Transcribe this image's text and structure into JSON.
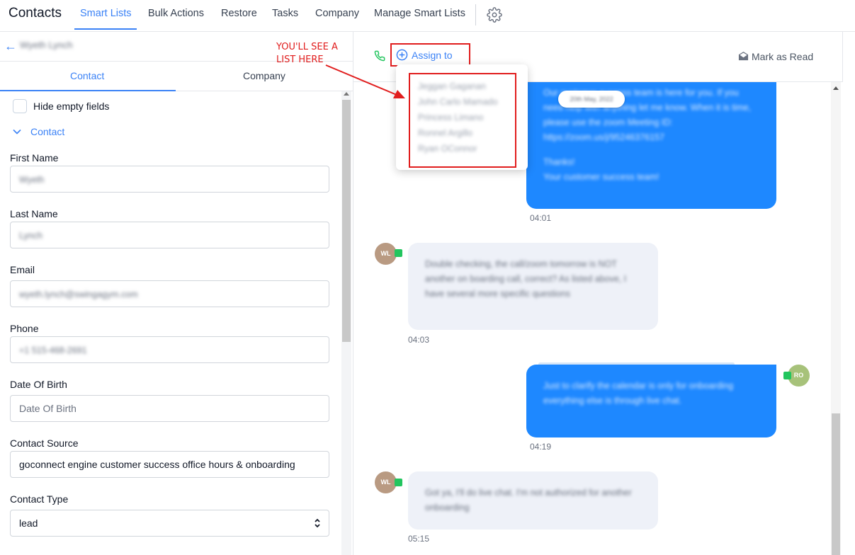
{
  "nav": {
    "app_title": "Contacts",
    "tabs": [
      "Smart Lists",
      "Bulk Actions",
      "Restore",
      "Tasks",
      "Company",
      "Manage Smart Lists"
    ],
    "settings_icon": "gear-icon"
  },
  "left": {
    "contact_name": "Wyeth Lynch",
    "subtabs": {
      "contact": "Contact",
      "company": "Company"
    },
    "hide_empty_label": "Hide empty fields",
    "section_title": "Contact",
    "fields": {
      "first_name": {
        "label": "First Name",
        "value": "Wyeth"
      },
      "last_name": {
        "label": "Last Name",
        "value": "Lynch"
      },
      "email": {
        "label": "Email",
        "value": "wyeth.lynch@swingagym.com"
      },
      "phone": {
        "label": "Phone",
        "value": "+1 515-468-2691"
      },
      "dob": {
        "label": "Date Of Birth",
        "placeholder": "Date Of Birth"
      },
      "source": {
        "label": "Contact Source",
        "value": "goconnect engine customer success office hours & onboarding"
      },
      "type": {
        "label": "Contact Type",
        "value": "lead"
      }
    }
  },
  "conversation": {
    "assign_label": "Assign to",
    "mark_read_label": "Mark as Read",
    "dropdown_items": [
      "Jeggan Gaganan",
      "John Carlo Mamado",
      "Princess Limano",
      "Ronnel Argillo",
      "Ryan OConnor"
    ],
    "date_pill": "20th May, 2022",
    "messages": [
      {
        "direction": "out",
        "text": "Our customer success team is here for you. If you need help with anything let me know. When it is time, please use the zoom Meeting ID: https://zoom.us/j/95246376157",
        "sign_off_1": "Thanks!",
        "sign_off_2": "Your customer success team!",
        "time": "04:01"
      },
      {
        "direction": "in",
        "avatar": "WL",
        "text": "Double checking, the call/zoom tomorrow is NOT another on boarding call, correct? As listed above, I have several more specific questions",
        "time": "04:03"
      },
      {
        "direction": "out",
        "avatar": "RO",
        "text": "Just to clarify the calendar is only for onboarding everything else is through live chat.",
        "time": "04:19"
      },
      {
        "direction": "in",
        "avatar": "WL",
        "text": "Got ya, I'll do live chat. I'm not authorized for another onboarding",
        "time": "05:15"
      }
    ]
  },
  "annotation": {
    "text_line1": "YOU'LL SEE A",
    "text_line2": "LIST HERE",
    "color": "#e11d1d"
  },
  "colors": {
    "accent": "#3b82f6",
    "outgoing_bubble": "#1e88ff",
    "incoming_bubble": "#eef1f8",
    "annotation": "#e11d1d"
  }
}
